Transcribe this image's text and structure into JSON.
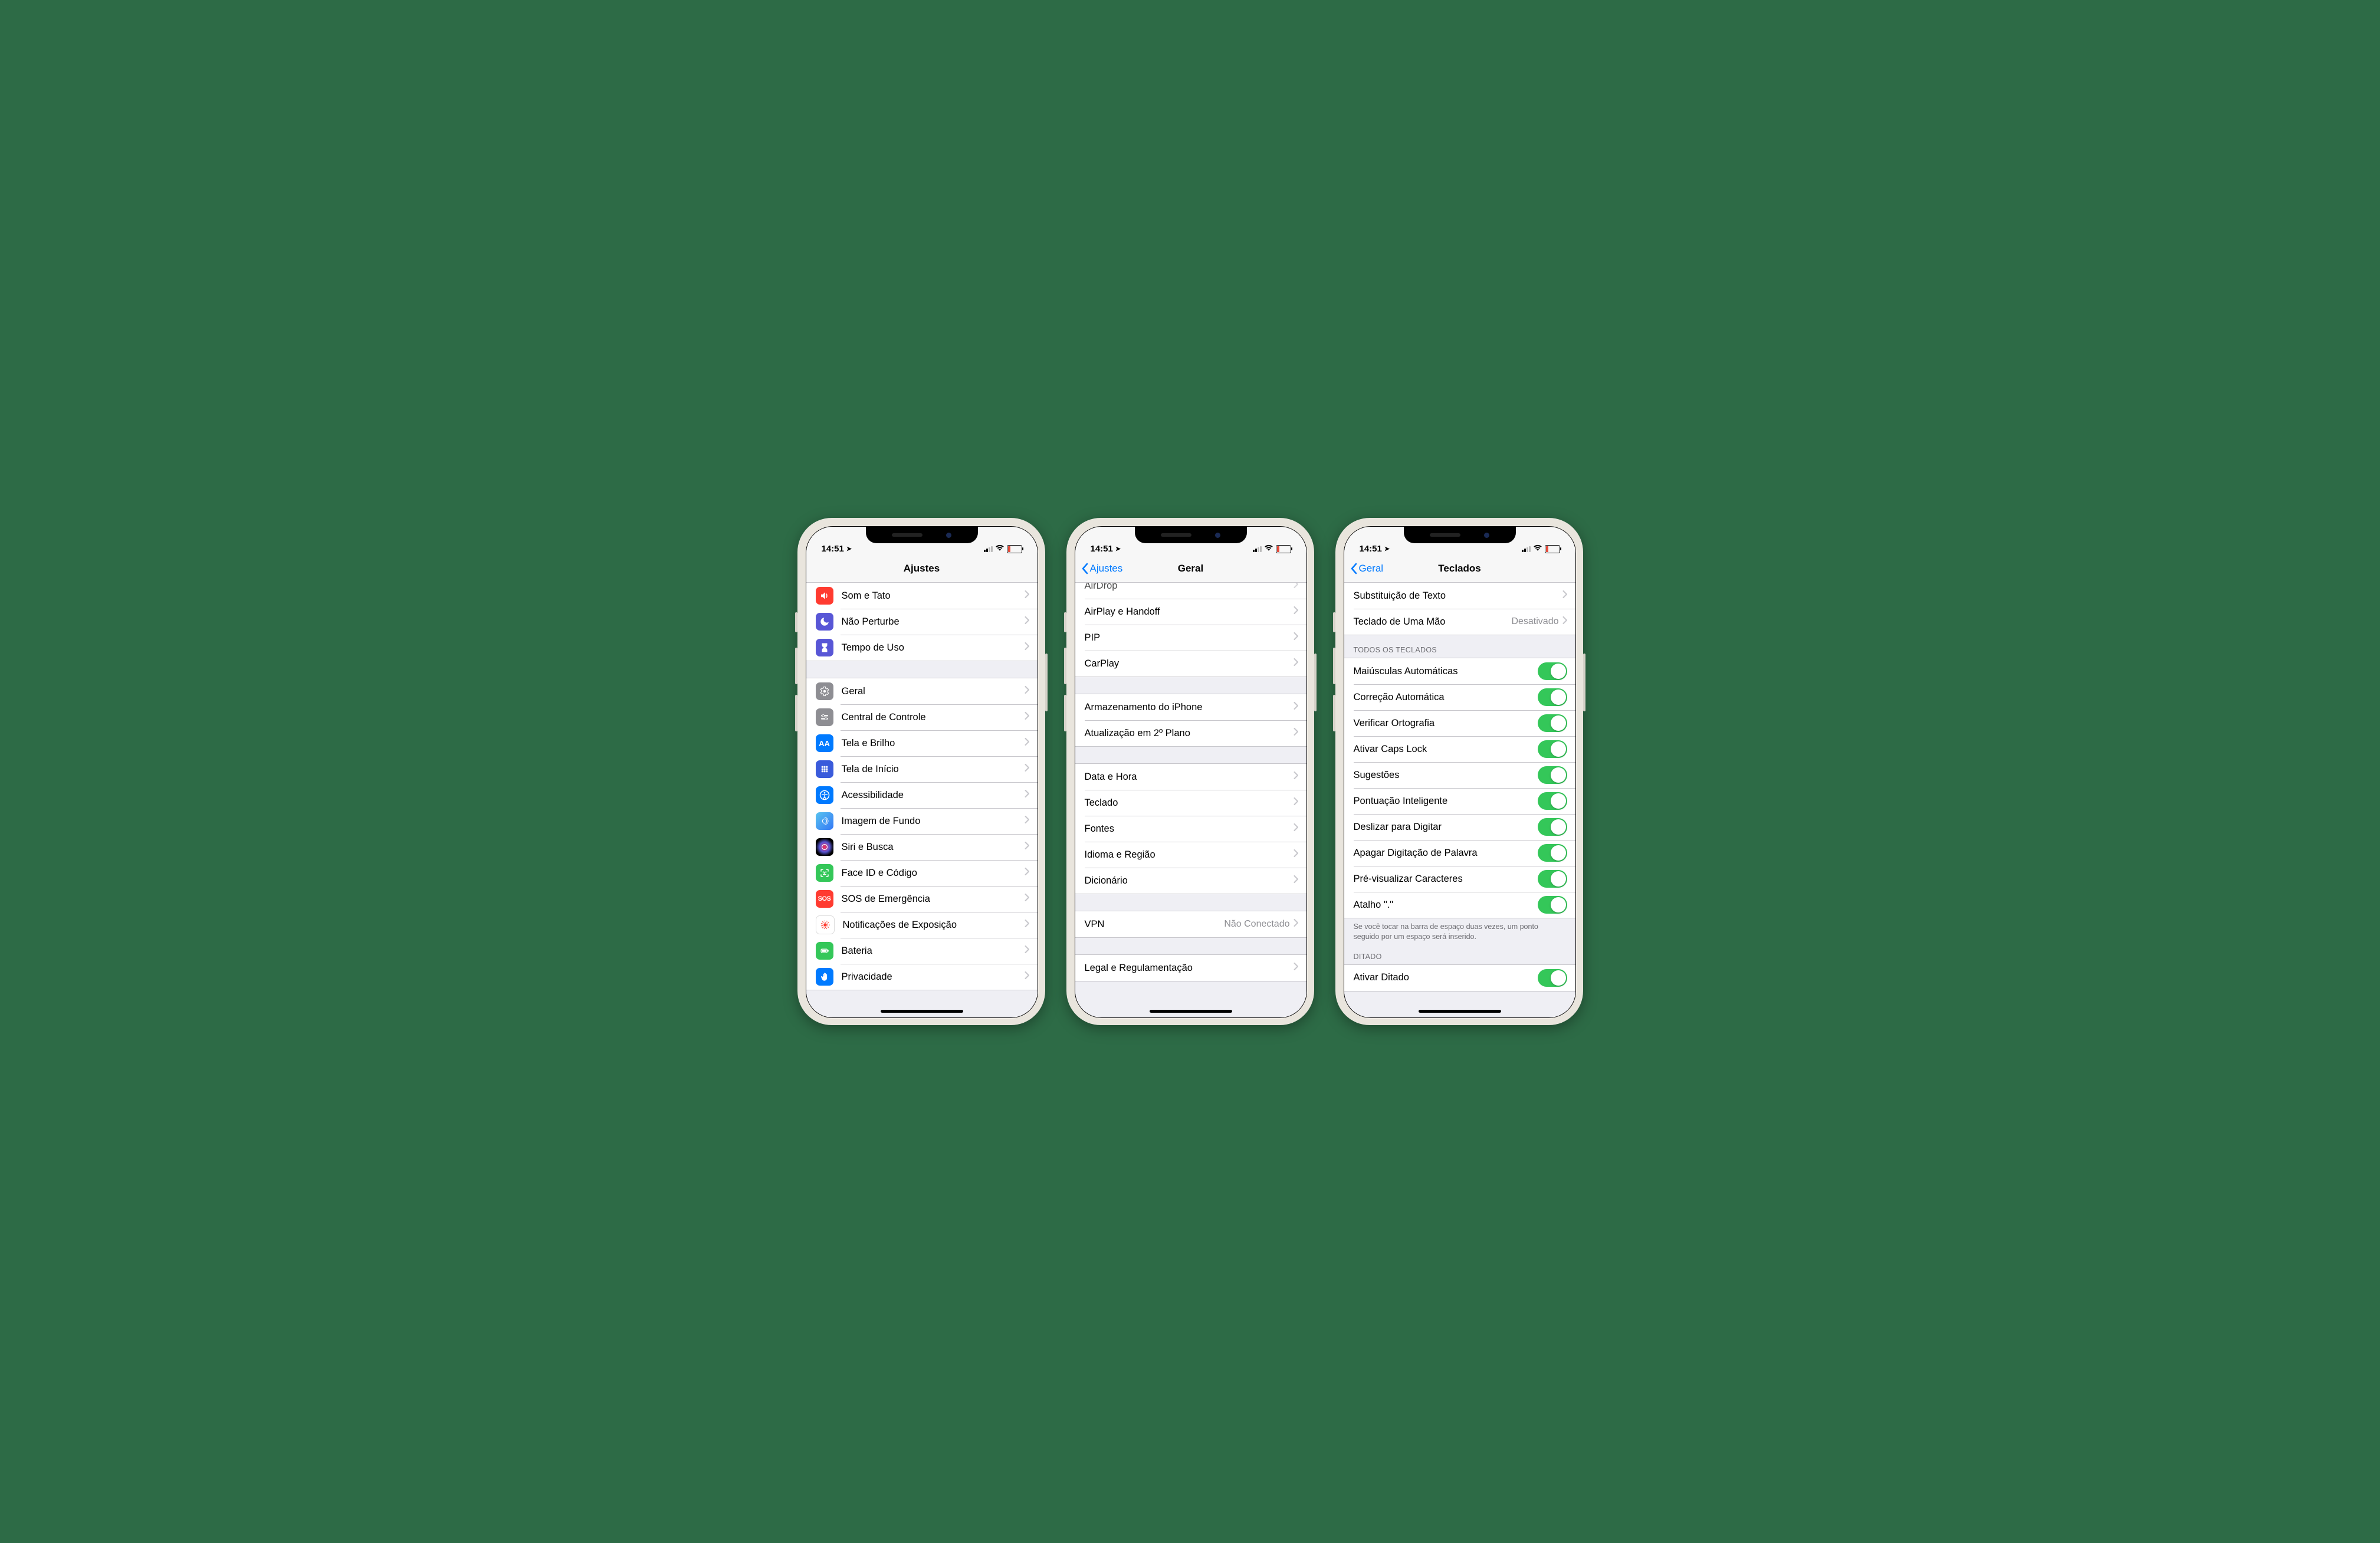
{
  "status": {
    "time": "14:51",
    "location_glyph": "➤"
  },
  "phone1": {
    "title": "Ajustes",
    "rows1": [
      {
        "id": "sounds",
        "label": "Som e Tato",
        "color": "#ff3b30"
      },
      {
        "id": "dnd",
        "label": "Não Perturbe",
        "color": "#5856d6"
      },
      {
        "id": "screentime",
        "label": "Tempo de Uso",
        "color": "#5856d6"
      }
    ],
    "rows2": [
      {
        "id": "general",
        "label": "Geral",
        "color": "#8e8e93"
      },
      {
        "id": "control",
        "label": "Central de Controle",
        "color": "#8e8e93"
      },
      {
        "id": "display",
        "label": "Tela e Brilho",
        "color": "#007aff"
      },
      {
        "id": "home",
        "label": "Tela de Início",
        "color": "#3a5bdb"
      },
      {
        "id": "accessibility",
        "label": "Acessibilidade",
        "color": "#007aff"
      },
      {
        "id": "wallpaper",
        "label": "Imagem de Fundo",
        "color": "wall"
      },
      {
        "id": "siri",
        "label": "Siri e Busca",
        "color": "siri"
      },
      {
        "id": "faceid",
        "label": "Face ID e Código",
        "color": "#34c759"
      },
      {
        "id": "sos",
        "label": "SOS de Emergência",
        "color": "#ff3b30"
      },
      {
        "id": "exposure",
        "label": "Notificações de Exposição",
        "color": "#fff"
      },
      {
        "id": "battery",
        "label": "Bateria",
        "color": "#34c759"
      },
      {
        "id": "privacy",
        "label": "Privacidade",
        "color": "#007aff"
      }
    ]
  },
  "phone2": {
    "back": "Ajustes",
    "title": "Geral",
    "g1": [
      {
        "label": "AirDrop"
      },
      {
        "label": "AirPlay e Handoff"
      },
      {
        "label": "PIP"
      },
      {
        "label": "CarPlay"
      }
    ],
    "g2": [
      {
        "label": "Armazenamento do iPhone"
      },
      {
        "label": "Atualização em 2º Plano"
      }
    ],
    "g3": [
      {
        "label": "Data e Hora"
      },
      {
        "label": "Teclado"
      },
      {
        "label": "Fontes"
      },
      {
        "label": "Idioma e Região"
      },
      {
        "label": "Dicionário"
      }
    ],
    "g4": [
      {
        "label": "VPN",
        "detail": "Não Conectado"
      }
    ],
    "g5": [
      {
        "label": "Legal e Regulamentação"
      }
    ]
  },
  "phone3": {
    "back": "Geral",
    "title": "Teclados",
    "top": [
      {
        "label": "Substituição de Texto"
      },
      {
        "label": "Teclado de Uma Mão",
        "detail": "Desativado"
      }
    ],
    "header1": "Todos os Teclados",
    "toggles": [
      {
        "label": "Maiúsculas Automáticas"
      },
      {
        "label": "Correção Automática"
      },
      {
        "label": "Verificar Ortografia"
      },
      {
        "label": "Ativar Caps Lock"
      },
      {
        "label": "Sugestões"
      },
      {
        "label": "Pontuação Inteligente"
      },
      {
        "label": "Deslizar para Digitar"
      },
      {
        "label": "Apagar Digitação de Palavra"
      },
      {
        "label": "Pré-visualizar Caracteres"
      },
      {
        "label": "Atalho \".\""
      }
    ],
    "footer1": "Se você tocar na barra de espaço duas vezes, um ponto seguido por um espaço será inserido.",
    "header2": "Ditado",
    "dictation": {
      "label": "Ativar Ditado"
    }
  }
}
